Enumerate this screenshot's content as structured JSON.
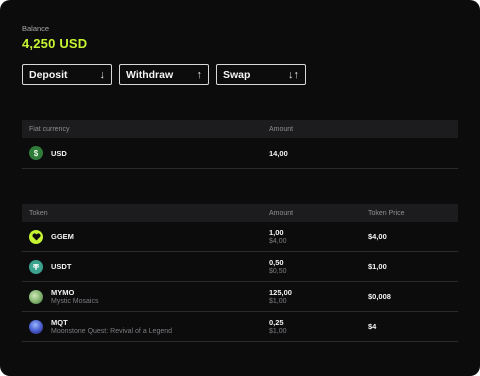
{
  "balance": {
    "label": "Balance",
    "value": "4,250 USD"
  },
  "actions": [
    {
      "label": "Deposit",
      "icon": "↓"
    },
    {
      "label": "Withdraw",
      "icon": "↑"
    },
    {
      "label": "Swap",
      "icon": "↓↑"
    }
  ],
  "fiat": {
    "headers": {
      "name": "Fiat currency",
      "amount": "Amount"
    },
    "rows": [
      {
        "name": "USD",
        "amount": "14,00",
        "icon_symbol": "$"
      }
    ]
  },
  "tokens": {
    "headers": {
      "name": "Token",
      "amount": "Amount",
      "price": "Token Price"
    },
    "rows": [
      {
        "symbol": "GGEM",
        "subtitle": "",
        "amount": "1,00",
        "amount_usd": "$4,00",
        "price": "$4,00"
      },
      {
        "symbol": "USDT",
        "subtitle": "",
        "amount": "0,50",
        "amount_usd": "$0,50",
        "price": "$1,00"
      },
      {
        "symbol": "MYMO",
        "subtitle": "Mystic Mosaics",
        "amount": "125,00",
        "amount_usd": "$1,00",
        "price": "$0,008"
      },
      {
        "symbol": "MQT",
        "subtitle": "Moonstone Quest: Revival of a Legend",
        "amount": "0,25",
        "amount_usd": "$1,00",
        "price": "$4"
      }
    ]
  },
  "colors": {
    "accent": "#c6f432",
    "background": "#0c0c0d",
    "header_bg": "#1c1c1e"
  },
  "icons": {
    "usd": "dollar-coin-icon",
    "ggem": "ggem-heart-icon",
    "usdt": "tether-icon",
    "mymo": "mymo-token-icon",
    "mqt": "mqt-token-icon"
  }
}
